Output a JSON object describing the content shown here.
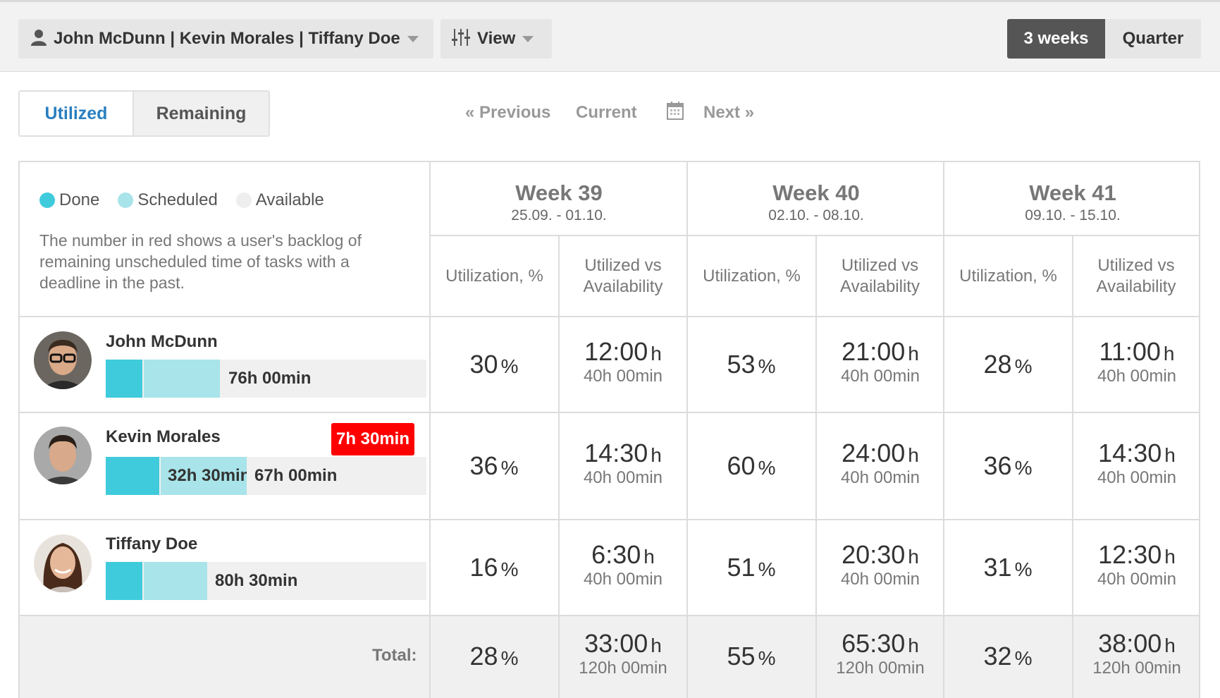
{
  "toolbar": {
    "user_filter_label": "John McDunn | Kevin Morales | Tiffany Doe",
    "view_label": "View",
    "range_options": [
      "3 weeks",
      "Quarter"
    ]
  },
  "tabs": [
    "Utilized",
    "Remaining"
  ],
  "pager": {
    "previous": "« Previous",
    "current": "Current",
    "next": "Next »"
  },
  "legend": {
    "done": "Done",
    "scheduled": "Scheduled",
    "available": "Available",
    "note": "The number in red shows a user's backlog of remaining unscheduled time of tasks with a deadline in the past.",
    "colors": {
      "done": "#3fcbdb",
      "scheduled": "#a8e4e9",
      "available": "#eeeeee"
    }
  },
  "weeks": [
    {
      "title": "Week 39",
      "dates": "25.09. - 01.10."
    },
    {
      "title": "Week 40",
      "dates": "02.10. - 08.10."
    },
    {
      "title": "Week 41",
      "dates": "09.10. - 15.10."
    }
  ],
  "sub_headers": {
    "utilization": "Utilization, %",
    "uva_line1": "Utilized vs",
    "uva_line2": "Availability"
  },
  "users": [
    {
      "name": "John McDunn",
      "bar_label": "76h 00min",
      "backlog": "",
      "weeks": [
        {
          "pct": "30",
          "hours": "12:00",
          "avail": "40h 00min"
        },
        {
          "pct": "53",
          "hours": "21:00",
          "avail": "40h 00min"
        },
        {
          "pct": "28",
          "hours": "11:00",
          "avail": "40h 00min"
        }
      ]
    },
    {
      "name": "Kevin Morales",
      "bar_label": "67h 00min",
      "bar_sched_label": "32h 30min",
      "backlog": "7h 30min",
      "weeks": [
        {
          "pct": "36",
          "hours": "14:30",
          "avail": "40h 00min"
        },
        {
          "pct": "60",
          "hours": "24:00",
          "avail": "40h 00min"
        },
        {
          "pct": "36",
          "hours": "14:30",
          "avail": "40h 00min"
        }
      ]
    },
    {
      "name": "Tiffany Doe",
      "bar_label": "80h 30min",
      "backlog": "",
      "weeks": [
        {
          "pct": "16",
          "hours": "6:30",
          "avail": "40h 00min"
        },
        {
          "pct": "51",
          "hours": "20:30",
          "avail": "40h 00min"
        },
        {
          "pct": "31",
          "hours": "12:30",
          "avail": "40h 00min"
        }
      ]
    }
  ],
  "total": {
    "label": "Total:",
    "weeks": [
      {
        "pct": "28",
        "hours": "33:00",
        "avail": "120h 00min"
      },
      {
        "pct": "55",
        "hours": "65:30",
        "avail": "120h 00min"
      },
      {
        "pct": "32",
        "hours": "38:00",
        "avail": "120h 00min"
      }
    ]
  },
  "units": {
    "pct": "%",
    "hours": "h"
  }
}
